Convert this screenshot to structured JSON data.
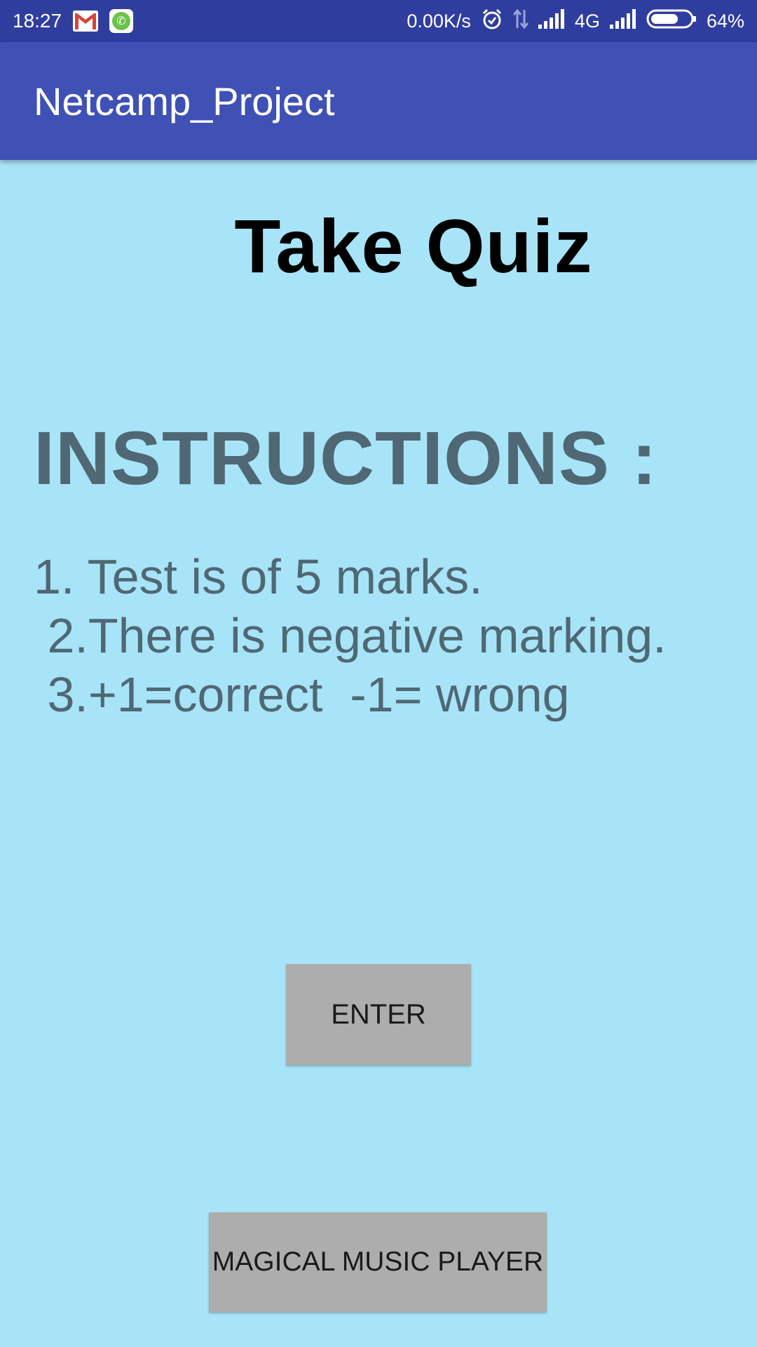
{
  "status_bar": {
    "time": "18:27",
    "network_speed": "0.00K/s",
    "network_type": "4G",
    "battery": "64%",
    "icons": [
      "gmail-icon",
      "phone-app-icon",
      "alarm-icon",
      "data-transfer-icon",
      "signal-icon",
      "signal-icon",
      "battery-icon"
    ]
  },
  "app_bar": {
    "title": "Netcamp_Project",
    "color": "#3f51b5"
  },
  "main": {
    "title": "Take Quiz",
    "instructions_heading": "INSTRUCTIONS :",
    "instructions_text": "1. Test is of 5 marks.\n 2.There is negative marking.\n 3.+1=correct  -1= wrong",
    "background": "#a8e4f8"
  },
  "buttons": {
    "enter_label": "ENTER",
    "music_player_label": "MAGICAL MUSIC PLAYER"
  }
}
